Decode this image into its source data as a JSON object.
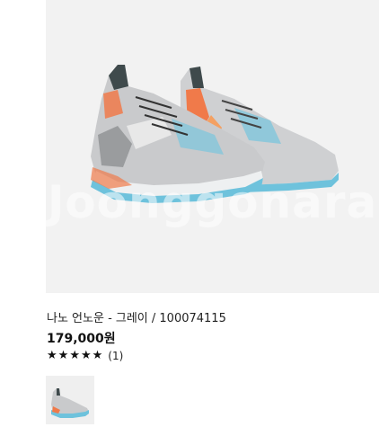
{
  "watermark": "Joonggonara",
  "product": {
    "title": "나노 언노운 - 그레이 / 100074115",
    "price": "179,000원",
    "rating_stars": 5,
    "review_count": "(1)"
  },
  "icons": {
    "star": "star-icon"
  },
  "colors": {
    "text": "#222222",
    "price": "#111111",
    "image_bg": "#f2f2f2",
    "shoe_gray": "#c9cacc",
    "accent_orange": "#f07a4a",
    "accent_blue": "#6ec2dc"
  }
}
